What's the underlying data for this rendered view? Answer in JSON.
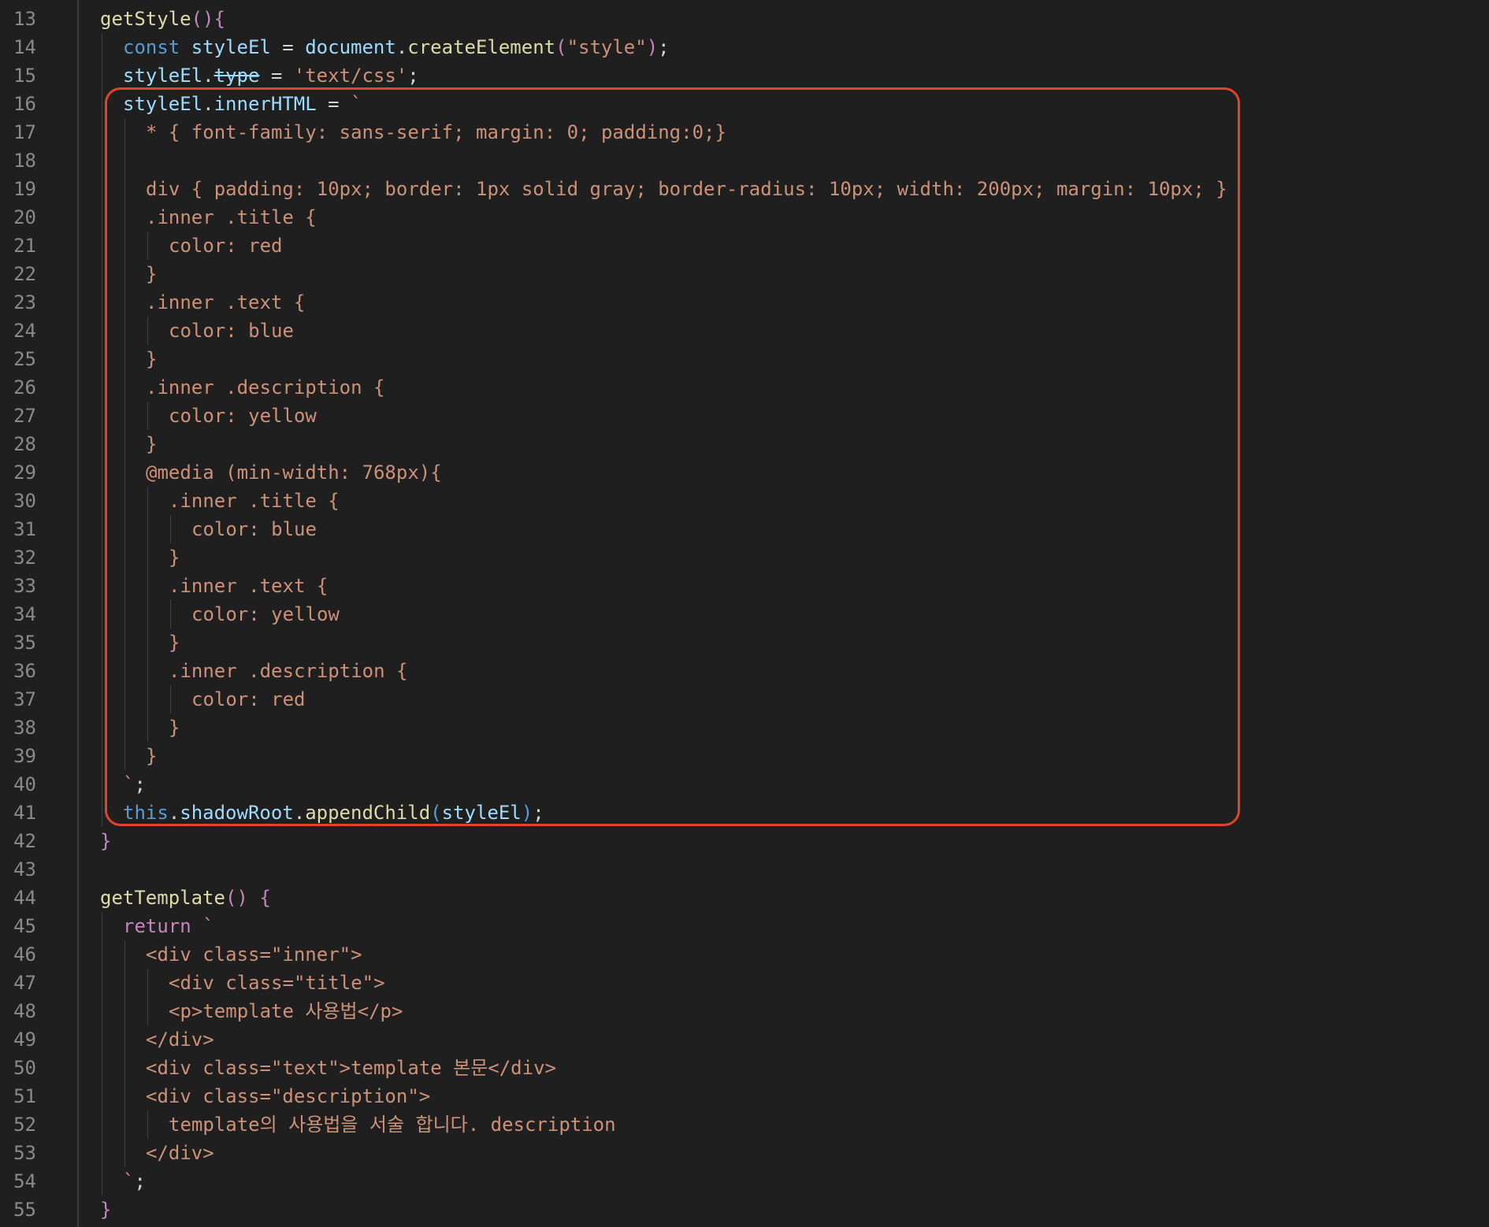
{
  "editor": {
    "lines": [
      {
        "n": "13",
        "indent": 0,
        "tokens": [
          [
            "getStyle",
            "fn"
          ],
          [
            "()",
            "pl"
          ],
          [
            "{",
            "pl"
          ]
        ]
      },
      {
        "n": "14",
        "indent": 1,
        "tokens": [
          [
            "const ",
            "kw"
          ],
          [
            "styleEl",
            "var"
          ],
          [
            " = ",
            "op"
          ],
          [
            "document",
            "var"
          ],
          [
            ".",
            "op"
          ],
          [
            "createElement",
            "fn"
          ],
          [
            "(",
            "pl"
          ],
          [
            "\"style\"",
            "str"
          ],
          [
            ")",
            "pl"
          ],
          [
            ";",
            "op"
          ]
        ]
      },
      {
        "n": "15",
        "indent": 1,
        "tokens": [
          [
            "styleEl",
            "var"
          ],
          [
            ".",
            "op"
          ],
          [
            "type",
            "dep"
          ],
          [
            " = ",
            "op"
          ],
          [
            "'text/css'",
            "str"
          ],
          [
            ";",
            "op"
          ]
        ]
      },
      {
        "n": "16",
        "indent": 1,
        "tokens": [
          [
            "styleEl",
            "var"
          ],
          [
            ".",
            "op"
          ],
          [
            "innerHTML",
            "var"
          ],
          [
            " = ",
            "op"
          ],
          [
            "`",
            "str"
          ]
        ]
      },
      {
        "n": "17",
        "indent": 2,
        "tokens": [
          [
            "* { font-family: sans-serif; margin: 0; padding:0;}",
            "str"
          ]
        ]
      },
      {
        "n": "18",
        "indent": 0,
        "tokens": []
      },
      {
        "n": "19",
        "indent": 2,
        "tokens": [
          [
            "div { padding: 10px; border: 1px solid gray; border-radius: 10px; width: 200px; margin: 10px; }",
            "str"
          ]
        ]
      },
      {
        "n": "20",
        "indent": 2,
        "tokens": [
          [
            ".inner .title {",
            "str"
          ]
        ]
      },
      {
        "n": "21",
        "indent": 3,
        "tokens": [
          [
            "color: red",
            "str"
          ]
        ]
      },
      {
        "n": "22",
        "indent": 2,
        "tokens": [
          [
            "}",
            "str"
          ]
        ]
      },
      {
        "n": "23",
        "indent": 2,
        "tokens": [
          [
            ".inner .text {",
            "str"
          ]
        ]
      },
      {
        "n": "24",
        "indent": 3,
        "tokens": [
          [
            "color: blue",
            "str"
          ]
        ]
      },
      {
        "n": "25",
        "indent": 2,
        "tokens": [
          [
            "}",
            "str"
          ]
        ]
      },
      {
        "n": "26",
        "indent": 2,
        "tokens": [
          [
            ".inner .description {",
            "str"
          ]
        ]
      },
      {
        "n": "27",
        "indent": 3,
        "tokens": [
          [
            "color: yellow",
            "str"
          ]
        ]
      },
      {
        "n": "28",
        "indent": 2,
        "tokens": [
          [
            "}",
            "str"
          ]
        ]
      },
      {
        "n": "29",
        "indent": 2,
        "tokens": [
          [
            "@media (min-width: 768px){",
            "str"
          ]
        ]
      },
      {
        "n": "30",
        "indent": 3,
        "tokens": [
          [
            ".inner .title {",
            "str"
          ]
        ]
      },
      {
        "n": "31",
        "indent": 4,
        "tokens": [
          [
            "color: blue",
            "str"
          ]
        ]
      },
      {
        "n": "32",
        "indent": 3,
        "tokens": [
          [
            "}",
            "str"
          ]
        ]
      },
      {
        "n": "33",
        "indent": 3,
        "tokens": [
          [
            ".inner .text {",
            "str"
          ]
        ]
      },
      {
        "n": "34",
        "indent": 4,
        "tokens": [
          [
            "color: yellow",
            "str"
          ]
        ]
      },
      {
        "n": "35",
        "indent": 3,
        "tokens": [
          [
            "}",
            "str"
          ]
        ]
      },
      {
        "n": "36",
        "indent": 3,
        "tokens": [
          [
            ".inner .description {",
            "str"
          ]
        ]
      },
      {
        "n": "37",
        "indent": 4,
        "tokens": [
          [
            "color: red",
            "str"
          ]
        ]
      },
      {
        "n": "38",
        "indent": 3,
        "tokens": [
          [
            "}",
            "str"
          ]
        ]
      },
      {
        "n": "39",
        "indent": 2,
        "tokens": [
          [
            "}",
            "str"
          ]
        ]
      },
      {
        "n": "40",
        "indent": 1,
        "tokens": [
          [
            "`",
            "str"
          ],
          [
            ";",
            "op"
          ]
        ]
      },
      {
        "n": "41",
        "indent": 1,
        "tokens": [
          [
            "this",
            "kw"
          ],
          [
            ".",
            "op"
          ],
          [
            "shadowRoot",
            "var"
          ],
          [
            ".",
            "op"
          ],
          [
            "appendChild",
            "fn"
          ],
          [
            "(",
            "kw"
          ],
          [
            "styleEl",
            "var"
          ],
          [
            ")",
            "kw"
          ],
          [
            ";",
            "op"
          ]
        ]
      },
      {
        "n": "42",
        "indent": 0,
        "tokens": [
          [
            "}",
            "pl"
          ]
        ]
      },
      {
        "n": "43",
        "indent": 0,
        "tokens": []
      },
      {
        "n": "44",
        "indent": 0,
        "tokens": [
          [
            "getTemplate",
            "fn"
          ],
          [
            "() ",
            "pl"
          ],
          [
            "{",
            "pl"
          ]
        ]
      },
      {
        "n": "45",
        "indent": 1,
        "tokens": [
          [
            "return ",
            "pl"
          ],
          [
            "`",
            "str"
          ]
        ]
      },
      {
        "n": "46",
        "indent": 2,
        "tokens": [
          [
            "<div class=\"inner\">",
            "str"
          ]
        ]
      },
      {
        "n": "47",
        "indent": 3,
        "tokens": [
          [
            "<div class=\"title\">",
            "str"
          ]
        ]
      },
      {
        "n": "48",
        "indent": 3,
        "tokens": [
          [
            "<p>template 사용법</p>",
            "str"
          ]
        ]
      },
      {
        "n": "49",
        "indent": 2,
        "tokens": [
          [
            "</div>",
            "str"
          ]
        ]
      },
      {
        "n": "50",
        "indent": 2,
        "tokens": [
          [
            "<div class=\"text\">template 본문</div>",
            "str"
          ]
        ]
      },
      {
        "n": "51",
        "indent": 2,
        "tokens": [
          [
            "<div class=\"description\">",
            "str"
          ]
        ]
      },
      {
        "n": "52",
        "indent": 3,
        "tokens": [
          [
            "template의 사용법을 서술 합니다. description",
            "str"
          ]
        ]
      },
      {
        "n": "53",
        "indent": 2,
        "tokens": [
          [
            "</div>",
            "str"
          ]
        ]
      },
      {
        "n": "54",
        "indent": 1,
        "tokens": [
          [
            "`",
            "str"
          ],
          [
            ";",
            "op"
          ]
        ]
      },
      {
        "n": "55",
        "indent": 0,
        "tokens": [
          [
            "}",
            "pl"
          ]
        ]
      }
    ]
  },
  "colors": {
    "background": "#1f1f1f",
    "line_number": "#8a8a8a",
    "keyword_purple": "#c586c0",
    "function_yellow": "#dcdcaa",
    "keyword_blue": "#569cd6",
    "variable_lightblue": "#9cdcfe",
    "string_orange": "#ce9178",
    "highlight_box": "#e2432a"
  }
}
